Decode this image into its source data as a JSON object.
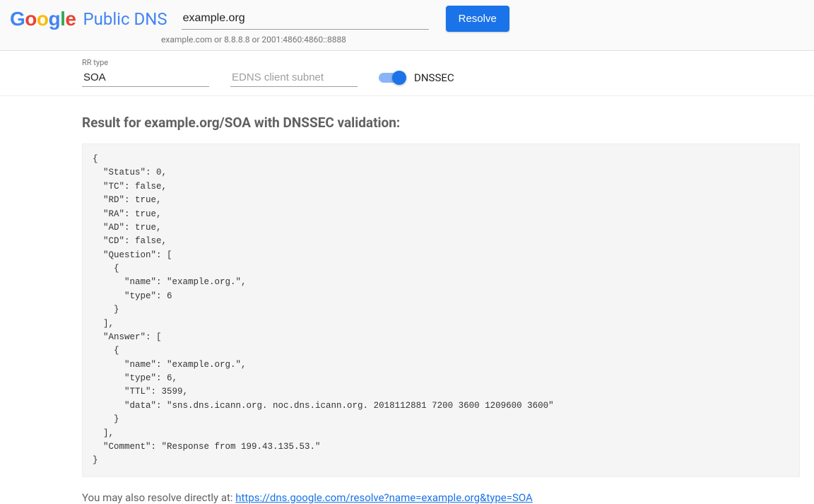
{
  "header": {
    "brand": "Public DNS",
    "query_value": "example.org",
    "query_hint": "example.com or 8.8.8.8 or 2001:4860:4860::8888",
    "resolve_label": "Resolve"
  },
  "params": {
    "rr_label": "RR type",
    "rr_value": "SOA",
    "edns_placeholder": "EDNS client subnet",
    "edns_value": "",
    "dnssec_label": "DNSSEC",
    "dnssec_on": true
  },
  "result": {
    "heading": "Result for example.org/SOA with DNSSEC validation:",
    "json_text": "{\n  \"Status\": 0,\n  \"TC\": false,\n  \"RD\": true,\n  \"RA\": true,\n  \"AD\": true,\n  \"CD\": false,\n  \"Question\": [\n    {\n      \"name\": \"example.org.\",\n      \"type\": 6\n    }\n  ],\n  \"Answer\": [\n    {\n      \"name\": \"example.org.\",\n      \"type\": 6,\n      \"TTL\": 3599,\n      \"data\": \"sns.dns.icann.org. noc.dns.icann.org. 2018112881 7200 3600 1209600 3600\"\n    }\n  ],\n  \"Comment\": \"Response from 199.43.135.53.\"\n}"
  },
  "footer": {
    "prefix": "You may also resolve directly at: ",
    "link_text": "https://dns.google.com/resolve?name=example.org&type=SOA",
    "link_href": "https://dns.google.com/resolve?name=example.org&type=SOA"
  }
}
